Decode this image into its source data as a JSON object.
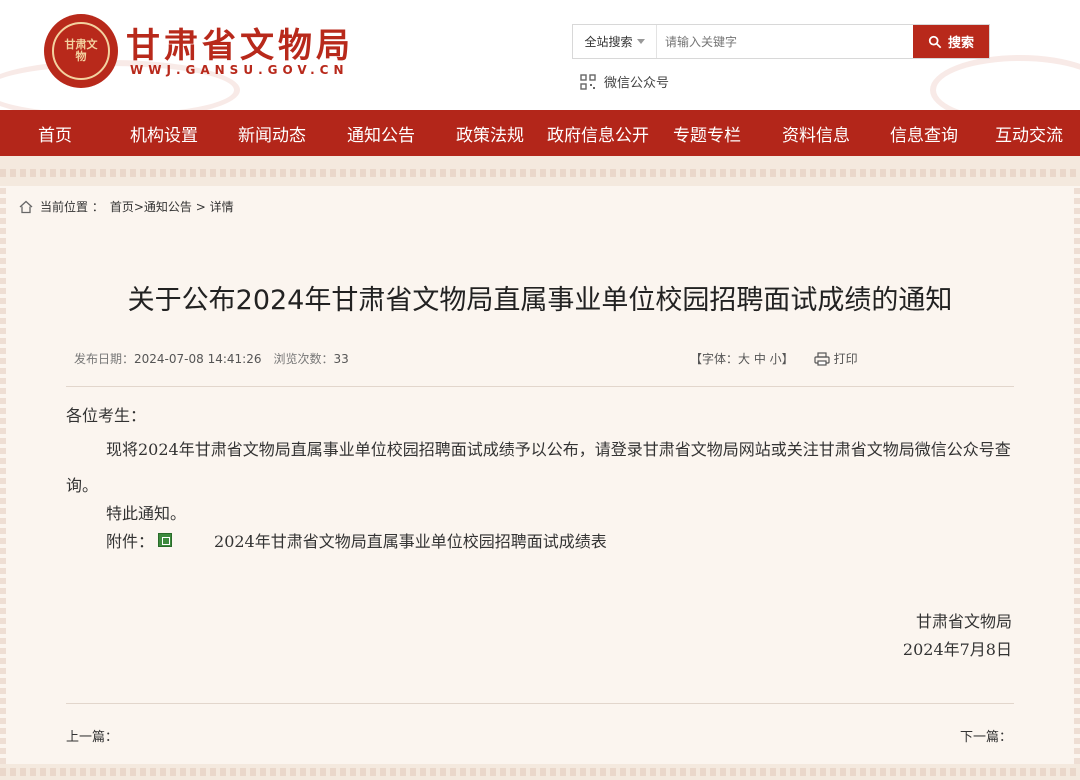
{
  "header": {
    "logo_text": "甘肃文物",
    "site_title": "甘肃省文物局",
    "site_url": "WWJ.GANSU.GOV.CN",
    "search_scope": "全站搜索",
    "search_placeholder": "请输入关键字",
    "search_button": "搜索",
    "wechat_label": "微信公众号"
  },
  "nav": {
    "items": [
      "首页",
      "机构设置",
      "新闻动态",
      "通知公告",
      "政策法规",
      "政府信息公开",
      "专题专栏",
      "资料信息",
      "信息查询",
      "互动交流"
    ]
  },
  "breadcrumb": {
    "label": "当前位置 ：",
    "path": "首页>通知公告 > 详情"
  },
  "article": {
    "title": "关于公布2024年甘肃省文物局直属事业单位校园招聘面试成绩的通知",
    "publish_label": "发布日期：",
    "publish_value": "2024-07-08 14:41:26",
    "views_label": "浏览次数：",
    "views_value": "33",
    "font_size_control": "【字体：大 中 小】",
    "print_label": "打印",
    "greeting": "各位考生：",
    "paragraph1": "现将2024年甘肃省文物局直属事业单位校园招聘面试成绩予以公布，请登录甘肃省文物局网站或关注甘肃省文物局微信公众号查询。",
    "paragraph2": "特此通知。",
    "attachment_label": "附件：",
    "attachment_name": "2024年甘肃省文物局直属事业单位校园招聘面试成绩表",
    "sign_org": "甘肃省文物局",
    "sign_date": "2024年7月8日",
    "prev_label": "上一篇：",
    "next_label": "下一篇："
  },
  "colors": {
    "brand_red": "#b3261a",
    "background": "#fbf5ef"
  }
}
